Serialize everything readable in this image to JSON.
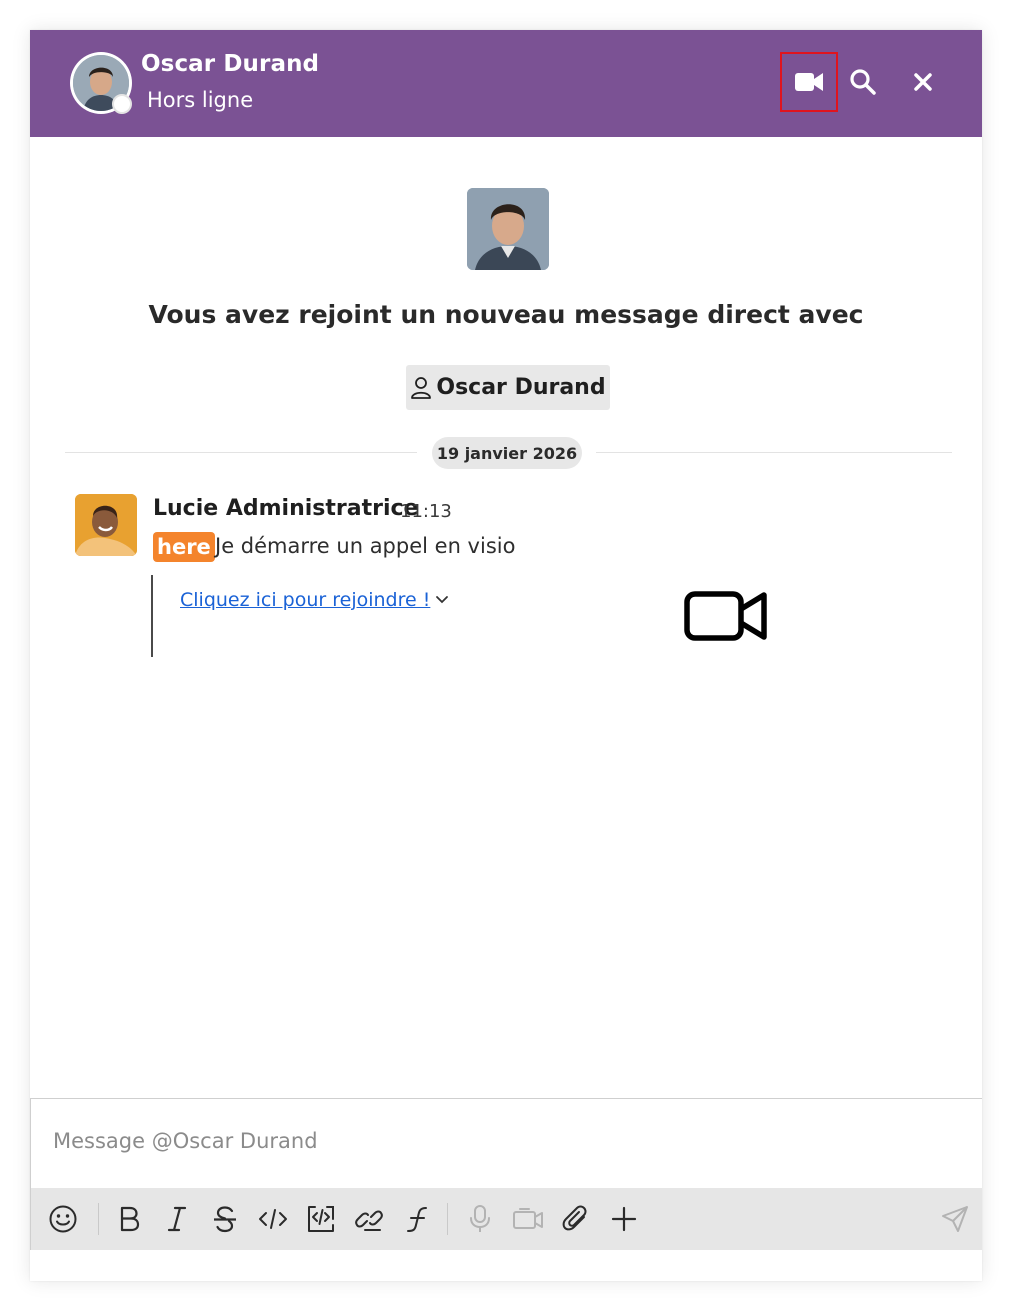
{
  "header": {
    "contact_name": "Oscar Durand",
    "status": "Hors ligne",
    "icons": {
      "video": "video-camera-icon",
      "search": "search-icon",
      "close": "close-icon"
    },
    "background_color": "#7b5294"
  },
  "intro": {
    "text": "Vous avez rejoint un nouveau message direct avec",
    "user_chip": "Oscar Durand"
  },
  "timeline": {
    "date": "19 janvier 2026"
  },
  "messages": [
    {
      "author": "Lucie Administratrice",
      "time": "11:13",
      "mention": "here",
      "text": "Je démarre un appel en visio",
      "link": "Cliquez ici pour rejoindre !"
    }
  ],
  "composer": {
    "placeholder": "Message @Oscar Durand",
    "toolbar": [
      "emoji-icon",
      "bold-icon",
      "italic-icon",
      "strikethrough-icon",
      "code-icon",
      "code-block-icon",
      "link-icon",
      "formula-icon",
      "microphone-icon",
      "video-message-icon",
      "attachment-icon",
      "plus-icon",
      "send-icon"
    ]
  },
  "colors": {
    "mention": "#f4842c",
    "link": "#1a62d6",
    "highlight_outline": "#e0141e"
  }
}
